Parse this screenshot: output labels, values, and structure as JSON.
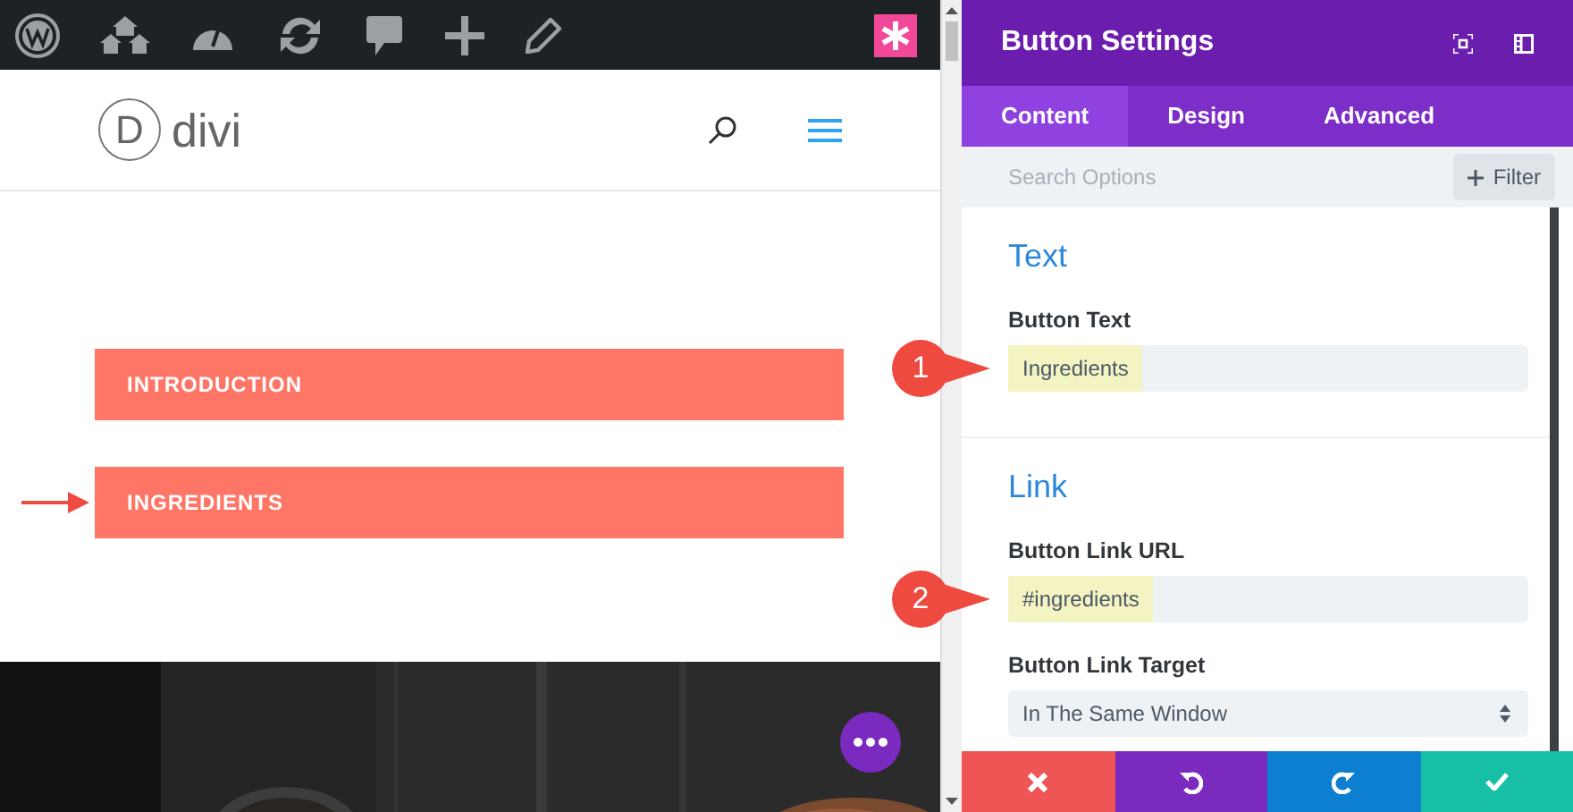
{
  "site_header": {
    "logo_letter": "D",
    "logo_text": "divi"
  },
  "page_buttons": [
    {
      "label": "INTRODUCTION",
      "pointed": false
    },
    {
      "label": "INGREDIENTS",
      "pointed": true
    }
  ],
  "settings": {
    "title": "Button Settings",
    "tabs": [
      {
        "label": "Content",
        "selected": true
      },
      {
        "label": "Design",
        "selected": false
      },
      {
        "label": "Advanced",
        "selected": false
      }
    ],
    "search": {
      "placeholder": "Search Options"
    },
    "filter_button": "Filter",
    "sections": [
      {
        "heading": "Text",
        "fields": [
          {
            "label": "Button Text",
            "kind": "text",
            "value": "Ingredients",
            "highlighted": true,
            "callout": "1"
          }
        ]
      },
      {
        "heading": "Link",
        "fields": [
          {
            "label": "Button Link URL",
            "kind": "text",
            "value": "#ingredients",
            "highlighted": true,
            "callout": "2"
          },
          {
            "label": "Button Link Target",
            "kind": "select",
            "value": "In The Same Window",
            "highlighted": false
          }
        ]
      }
    ]
  }
}
